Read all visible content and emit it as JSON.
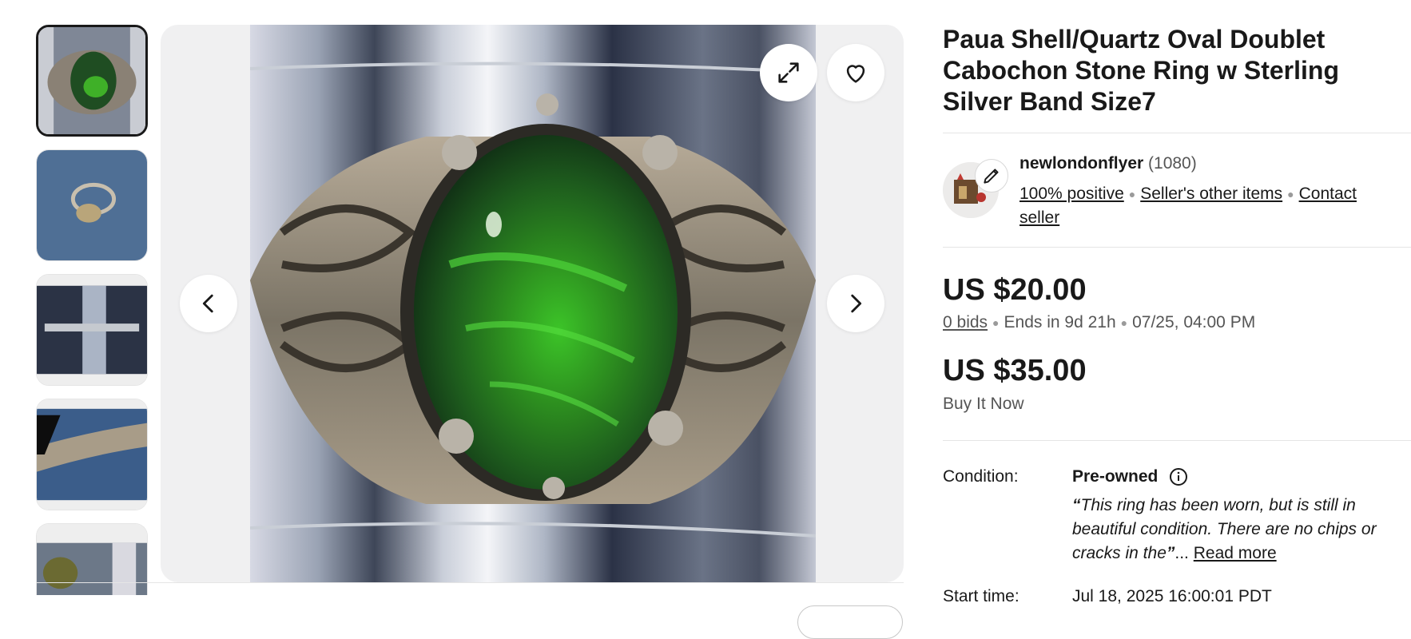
{
  "gallery": {
    "thumbnail_count_visible": 5,
    "selected_index": 0,
    "thumbnails": [
      {
        "alt": "ring top view"
      },
      {
        "alt": "ring side view"
      },
      {
        "alt": "ring size gauge"
      },
      {
        "alt": "ring band inscription"
      },
      {
        "alt": "ring measurement"
      }
    ],
    "buttons": {
      "expand_icon": "expand-icon",
      "watch_icon": "heart-icon",
      "prev_icon": "chevron-left-icon",
      "next_icon": "chevron-right-icon"
    }
  },
  "listing": {
    "title": "Paua Shell/Quartz Oval Doublet Cabochon Stone Ring w Sterling Silver Band Size7"
  },
  "seller": {
    "name": "newlondonflyer",
    "feedback_count": "(1080)",
    "positive": "100% positive",
    "other_items": "Seller's other items",
    "contact": "Contact seller"
  },
  "pricing": {
    "auction_price": "US $20.00",
    "bids": "0 bids",
    "ends_in": "Ends in 9d 21h",
    "end_date": "07/25, 04:00 PM",
    "buy_now_price": "US $35.00",
    "buy_now_label": "Buy It Now"
  },
  "details": {
    "condition_label": "Condition:",
    "condition_value": "Pre-owned",
    "quote_open": "“",
    "condition_note": "This ring has been worn, but is still in beautiful condition. There are no chips or cracks in the",
    "quote_close": "”",
    "ellipsis": "...",
    "read_more": "Read more",
    "start_time_label": "Start time:",
    "start_time_value": "Jul 18, 2025 16:00:01 PDT"
  },
  "colors": {
    "text": "#191919",
    "muted": "#555555",
    "stone_green": "#2f8a1e",
    "silver": "#9aa3ad"
  }
}
